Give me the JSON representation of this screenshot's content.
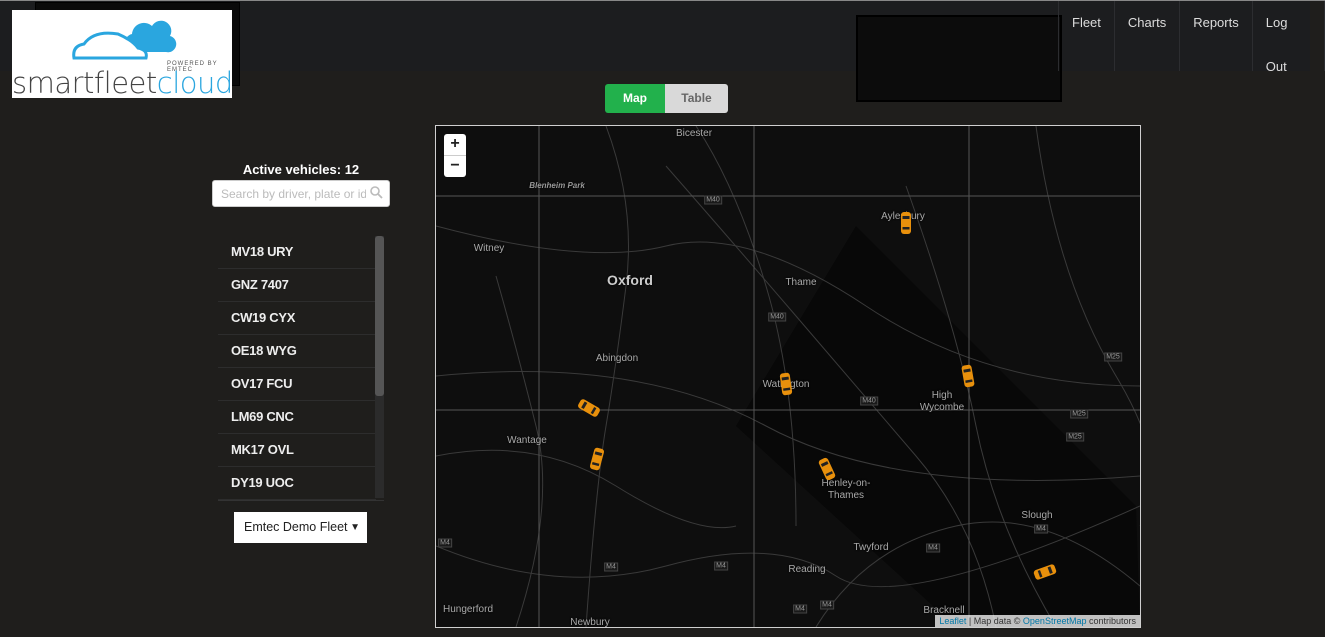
{
  "brand": {
    "logo_text_dark": "smartfleet",
    "logo_text_blue": "cloud",
    "tagline": "POWERED BY EMTEC",
    "brand_blue": "#2aa6df"
  },
  "nav": [
    {
      "label": "Fleet"
    },
    {
      "label": "Charts"
    },
    {
      "label": "Reports"
    },
    {
      "label": "Log Out"
    }
  ],
  "view_toggle": {
    "map": "Map",
    "table": "Table",
    "active": "Map",
    "active_color": "#22b14c"
  },
  "sidebar": {
    "active_vehicles": "Active vehicles: 12",
    "search_placeholder": "Search by driver, plate or id",
    "vehicles": [
      "MV18 URY",
      "GNZ 7407",
      "CW19 CYX",
      "OE18 WYG",
      "OV17 FCU",
      "LM69 CNC",
      "MK17 OVL",
      "DY19 UOC"
    ],
    "fleet_select": "Emtec Demo Fleet"
  },
  "map": {
    "zoom_in": "+",
    "zoom_out": "−",
    "places": [
      "Bicester",
      "Blenheim Park",
      "Witney",
      "Oxford",
      "Thame",
      "Aylesbury",
      "Abingdon",
      "Watlington",
      "High Wycombe",
      "Wantage",
      "Henley-on-Thames",
      "Slough",
      "Twyford",
      "Reading",
      "Hungerford",
      "Newbury",
      "Bracknell"
    ],
    "motorways": [
      "M40",
      "M40",
      "M40",
      "M25",
      "M25",
      "M25",
      "M4",
      "M4",
      "M4",
      "M4",
      "M4",
      "M4",
      "M4"
    ],
    "attribution": {
      "leaflet": "Leaflet",
      "sep": " | Map data © ",
      "osm": "OpenStreetMap",
      "suffix": " contributors"
    },
    "marker_color": "#e8900c",
    "vehicle_markers": 7
  }
}
